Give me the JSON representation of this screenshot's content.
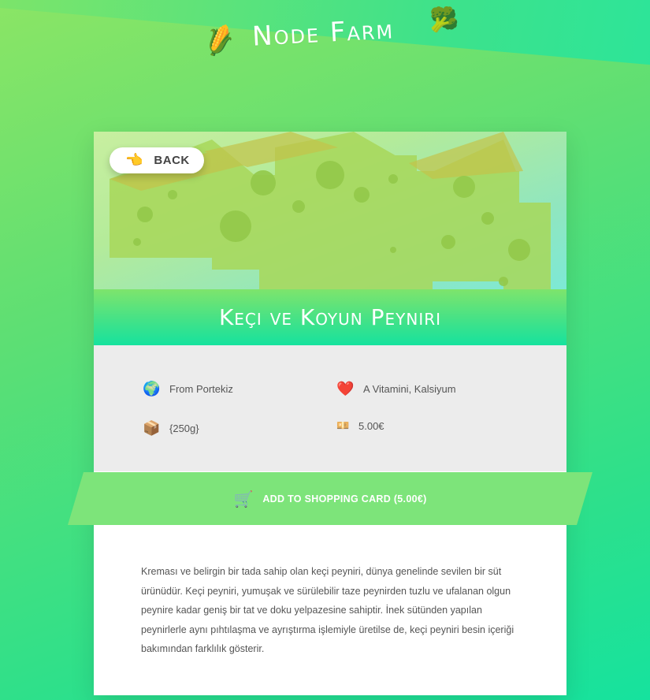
{
  "header": {
    "brand": "Node Farm",
    "left_icon": "corn-icon",
    "right_icon": "broccoli-icon"
  },
  "product": {
    "back_label": "BACK",
    "title": "Keçi ve Koyun Peynırı",
    "origin": "From Portekiz",
    "nutrients": "A Vitamini, Kalsiyum",
    "quantity": "{250g}",
    "price": "5.00€",
    "add_to_cart": "ADD TO SHOPPING CARD (5.00€)",
    "description": "Kreması ve belirgin bir tada sahip olan keçi peyniri, dünya genelinde sevilen bir süt ürünüdür. Keçi peyniri, yumuşak ve sürülebilir taze peynirden tuzlu ve ufalanan olgun peynire kadar geniş bir tat ve doku yelpazesine sahiptir. İnek sütünden yapılan peynirlerle aynı pıhtılaşma ve ayrıştırma işlemiyle üretilse de, keçi peyniri besin içeriği bakımından farklılık gösterir."
  },
  "colors": {
    "accent": "#7de47a",
    "title_band": "#16e29e"
  }
}
